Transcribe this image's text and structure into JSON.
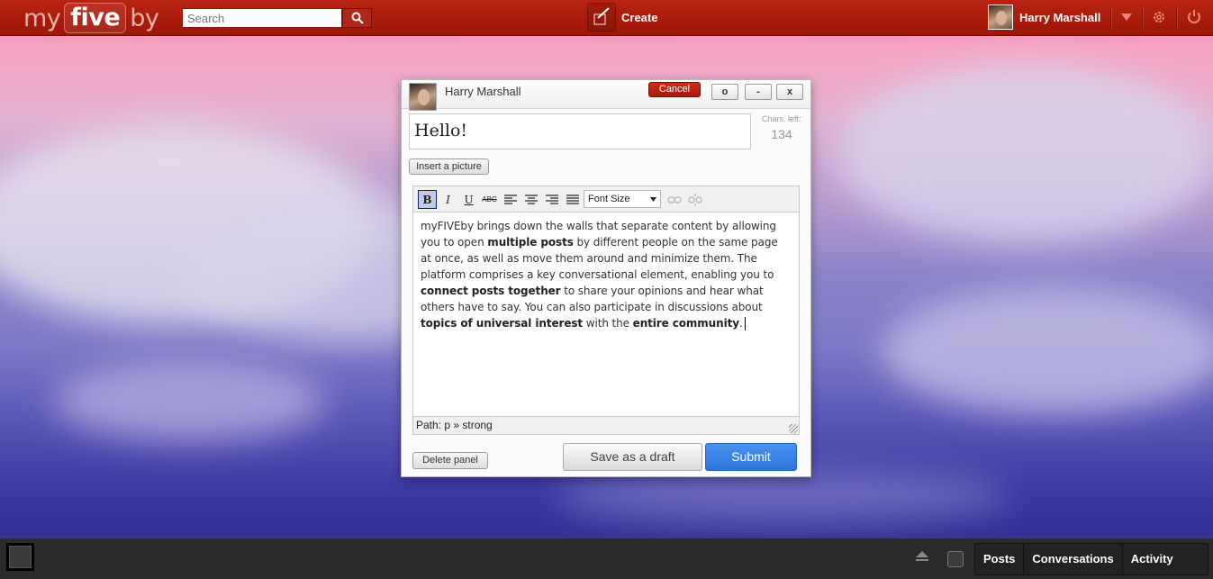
{
  "header": {
    "logo": {
      "my": "my",
      "five": "five",
      "by": "by"
    },
    "search_placeholder": "Search",
    "search_icon": "search-icon",
    "create_label": "Create",
    "create_icon": "pencil-icon",
    "user_name": "Harry Marshall",
    "icons": [
      "dropdown-arrow-icon",
      "gear-icon",
      "power-icon"
    ]
  },
  "panel": {
    "author": "Harry Marshall",
    "cancel_label": "Cancel",
    "window_buttons": [
      "o",
      "-",
      "x"
    ],
    "title_value": "Hello!",
    "chars_left_label": "Chars. left:",
    "chars_left_value": "134",
    "insert_picture_label": "Insert a picture",
    "toolbar": {
      "bold": "B",
      "italic": "I",
      "underline": "U",
      "strikethrough": "ABC",
      "font_size_label": "Font Size"
    },
    "content_segments": [
      {
        "text": "myFIVEby brings down the walls that separate content by allowing you to open ",
        "bold": false
      },
      {
        "text": "multiple posts",
        "bold": true
      },
      {
        "text": " by different people on the same page at once, as well as move them around and minimize them. The platform comprises a key conversational element, enabling you to ",
        "bold": false
      },
      {
        "text": "connect posts together",
        "bold": true
      },
      {
        "text": " to share your opinions and hear what others have to say. You can also participate in discussions about ",
        "bold": false
      },
      {
        "text": "topics of universal interest",
        "bold": true
      },
      {
        "text": " with the ",
        "bold": false
      },
      {
        "text": "entire community",
        "bold": true
      },
      {
        "text": ".",
        "bold": false
      }
    ],
    "path_label": "Path: p » strong",
    "delete_label": "Delete panel",
    "draft_label": "Save as a draft",
    "submit_label": "Submit"
  },
  "footer": {
    "tabs": [
      "Posts",
      "Conversations",
      "Activity"
    ]
  }
}
